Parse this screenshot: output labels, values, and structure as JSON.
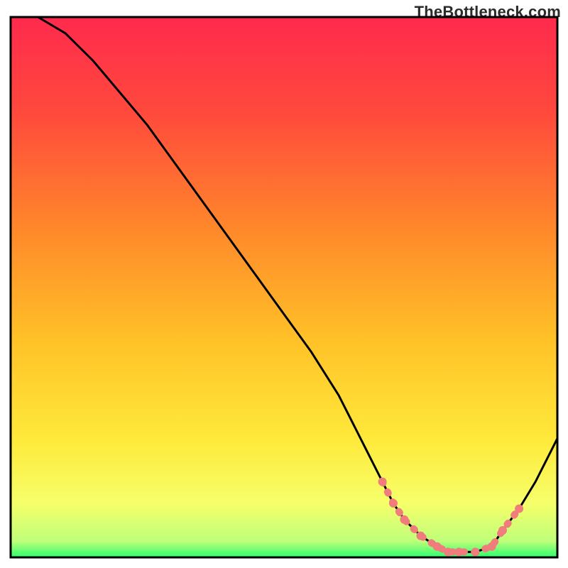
{
  "attribution": "TheBottleneck.com",
  "colors": {
    "curve": "#000000",
    "highlight": "#f07c7c",
    "frame": "#000000"
  },
  "chart_data": {
    "type": "line",
    "title": "",
    "xlabel": "",
    "ylabel": "",
    "xlim": [
      0,
      100
    ],
    "ylim": [
      0,
      100
    ],
    "x": [
      0,
      5,
      10,
      15,
      20,
      25,
      30,
      35,
      40,
      45,
      50,
      55,
      60,
      62,
      65,
      68,
      70,
      72,
      75,
      78,
      80,
      82,
      85,
      88,
      90,
      93,
      96,
      100
    ],
    "values": [
      110,
      103,
      97,
      92,
      86,
      80,
      73,
      66,
      59,
      52,
      45,
      38,
      30,
      26,
      20,
      14,
      10,
      7,
      4,
      2,
      1,
      1,
      1,
      2,
      5,
      9,
      14,
      22
    ],
    "highlight_indices": [
      15,
      16,
      17,
      18,
      19,
      20,
      21,
      22,
      23,
      24,
      25
    ]
  }
}
